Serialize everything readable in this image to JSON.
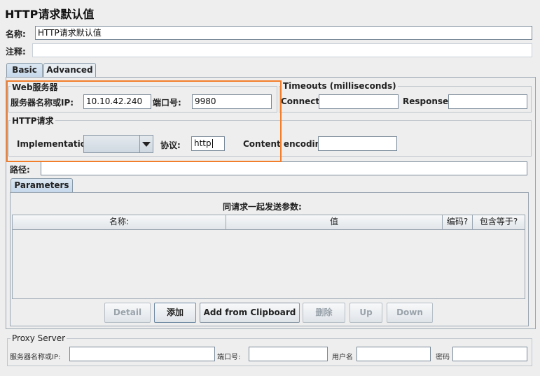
{
  "title": "HTTP请求默认值",
  "name_label": "名称:",
  "name_value": "HTTP请求默认值",
  "comment_label": "注释:",
  "comment_value": "",
  "tabs": [
    "Basic",
    "Advanced"
  ],
  "web_server": {
    "group_title": "Web服务器",
    "server_label": "服务器名称或IP:",
    "server_value": "10.10.42.240",
    "port_label": "端口号:",
    "port_value": "9980"
  },
  "timeouts": {
    "group_title": "Timeouts (milliseconds)",
    "connect_label": "Connect:",
    "connect_value": "",
    "response_label": "Response:",
    "response_value": ""
  },
  "http_request": {
    "group_title": "HTTP请求",
    "implementation_label": "Implementation:",
    "implementation_value": "",
    "protocol_label": "协议:",
    "protocol_value": "http",
    "encoding_label": "Content encoding:",
    "encoding_value": ""
  },
  "path_label": "路径:",
  "path_value": "",
  "parameters": {
    "tab_label": "Parameters",
    "caption": "同请求一起发送参数:",
    "columns": [
      "名称:",
      "值",
      "编码?",
      "包含等于?"
    ],
    "rows": []
  },
  "buttons": {
    "detail": "Detail",
    "add": "添加",
    "add_clipboard": "Add from Clipboard",
    "delete": "删除",
    "up": "Up",
    "down": "Down"
  },
  "proxy": {
    "group_title": "Proxy Server",
    "server_label": "服务器名称或IP:",
    "server_value": "",
    "port_label": "端口号:",
    "port_value": "",
    "user_label": "用户名",
    "user_value": "",
    "password_label": "密码",
    "password_value": ""
  },
  "colors": {
    "highlight": "#f27d2a",
    "background": "#eeeeee",
    "tab_active": "#c4d7ea"
  }
}
